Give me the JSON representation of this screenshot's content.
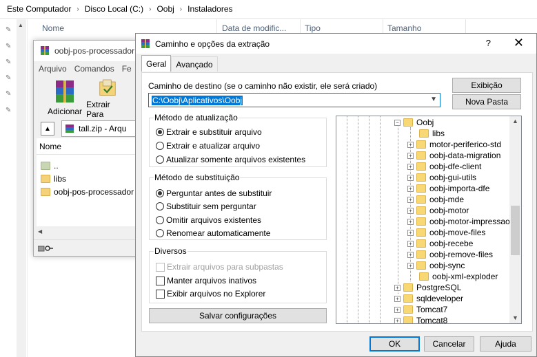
{
  "explorer": {
    "breadcrumb": [
      "Este Computador",
      "Disco Local (C:)",
      "Oobj",
      "Instaladores"
    ],
    "columns": [
      "Nome",
      "Data de modific...",
      "Tipo",
      "Tamanho"
    ]
  },
  "rar": {
    "title": "oobj-pos-processador",
    "menu": [
      "Arquivo",
      "Comandos",
      "Fe"
    ],
    "toolbar": {
      "add": "Adicionar",
      "extract": "Extrair Para"
    },
    "path": "tall.zip - Arqu",
    "list_header": "Nome",
    "items": [
      "..",
      "libs",
      "oobj-pos-processador"
    ]
  },
  "dialog": {
    "title": "Caminho e opções da extração",
    "help": "?",
    "tabs": [
      "Geral",
      "Avançado"
    ],
    "dest_label": "Caminho de destino (se o caminho não existir, ele será criado)",
    "dest_value": "C:\\Oobj\\Aplicativos\\Oobj",
    "btn_view": "Exibição",
    "btn_new_folder": "Nova Pasta",
    "update_group": {
      "title": "Método de atualização",
      "options": [
        "Extrair e substituir arquivo",
        "Extrair e atualizar arquivo",
        "Atualizar somente arquivos existentes"
      ],
      "selected": 0
    },
    "overwrite_group": {
      "title": "Método de substituição",
      "options": [
        "Perguntar antes de substituir",
        "Substituir sem perguntar",
        "Omitir arquivos existentes",
        "Renomear automaticamente"
      ],
      "selected": 0
    },
    "misc_group": {
      "title": "Diversos",
      "options": [
        "Extrair arquivos para subpastas",
        "Manter arquivos inativos",
        "Exibir arquivos no Explorer"
      ]
    },
    "save_settings": "Salvar configurações",
    "tree": {
      "parent": "Oobj",
      "children": [
        "libs",
        "motor-periferico-std",
        "oobj-data-migration",
        "oobj-dfe-client",
        "oobj-gui-utils",
        "oobj-importa-dfe",
        "oobj-mde",
        "oobj-motor",
        "oobj-motor-impressao",
        "oobj-move-files",
        "oobj-recebe",
        "oobj-remove-files",
        "oobj-sync",
        "oobj-xml-exploder"
      ],
      "siblings": [
        "PostgreSQL",
        "sqldeveloper",
        "Tomcat7",
        "Tomcat8"
      ]
    },
    "ok": "OK",
    "cancel": "Cancelar",
    "help_btn": "Ajuda"
  }
}
